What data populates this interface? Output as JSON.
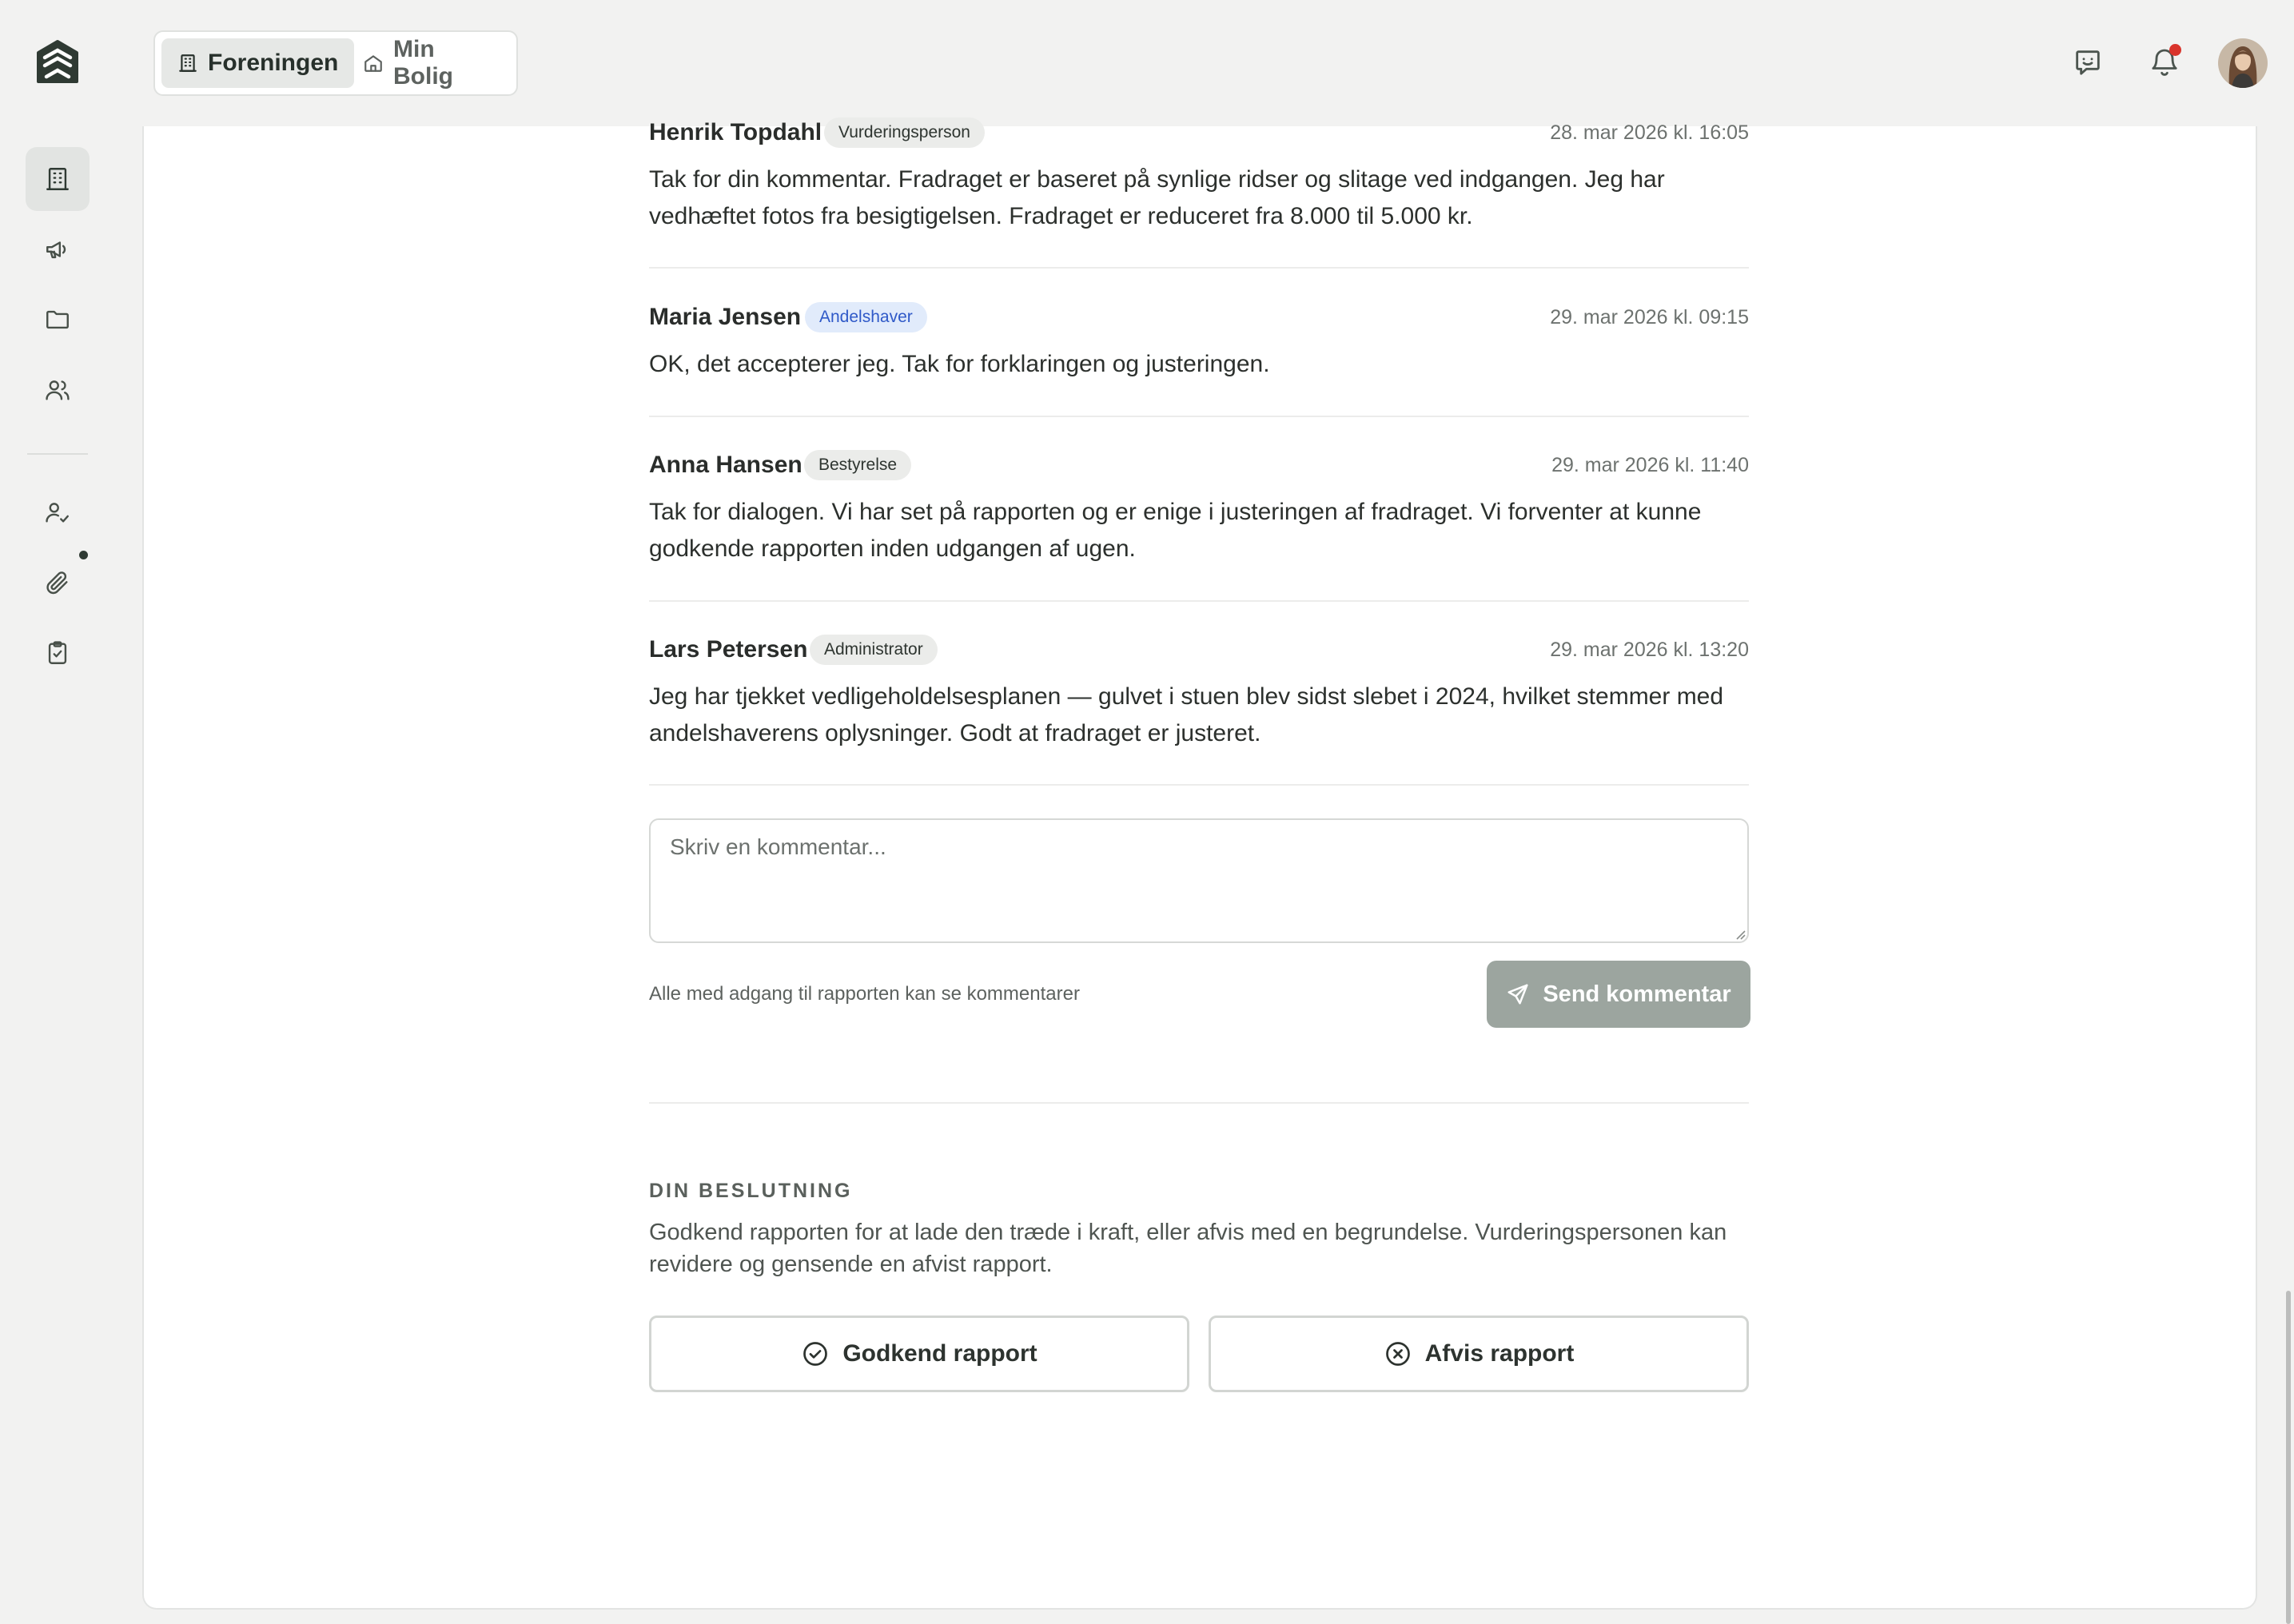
{
  "nav": {
    "tabs": [
      {
        "label": "Foreningen",
        "icon": "building-icon",
        "active": true
      },
      {
        "label": "Min Bolig",
        "icon": "home-icon",
        "active": false
      }
    ],
    "rail_icons": [
      "building-icon",
      "megaphone-icon",
      "folder-icon",
      "users-icon",
      "user-check-icon",
      "paperclip-icon",
      "clipboard-check-icon"
    ],
    "has_notification": true
  },
  "comments": [
    {
      "author": "Henrik Topdahl",
      "role": "Vurderingsperson",
      "time": "28. mar 2026 kl. 16:05",
      "body": "Tak for din kommentar. Fradraget er baseret på synlige ridser og slitage ved indgangen. Jeg har vedhæftet fotos fra besigtigelsen. Fradraget er reduceret fra 8.000 til 5.000 kr."
    },
    {
      "author": "Maria Jensen",
      "role": "Andelshaver",
      "time": "29. mar 2026 kl. 09:15",
      "body": "OK, det accepterer jeg. Tak for forklaringen og justeringen."
    },
    {
      "author": "Anna Hansen",
      "role": "Bestyrelse",
      "time": "29. mar 2026 kl. 11:40",
      "body": "Tak for dialogen. Vi har set på rapporten og er enige i justeringen af fradraget. Vi forventer at kunne godkende rapporten inden udgangen af ugen."
    },
    {
      "author": "Lars Petersen",
      "role": "Administrator",
      "time": "29. mar 2026 kl. 13:20",
      "body": "Jeg har tjekket vedligeholdelsesplanen — gulvet i stuen blev sidst slebet i 2024, hvilket stemmer med andelshaverens oplysninger. Godt at fradraget er justeret."
    }
  ],
  "composer": {
    "placeholder": "Skriv en kommentar...",
    "value": "",
    "hint": "Alle med adgang til rapporten kan se kommentarer",
    "send_label": "Send kommentar"
  },
  "decision": {
    "heading": "DIN BESLUTNING",
    "description": "Godkend rapporten for at lade den træde i kraft, eller afvis med en begrundelse. Vurderingspersonen kan revidere og gensende en afvist rapport.",
    "approve_label": "Godkend rapport",
    "reject_label": "Afvis rapport"
  },
  "colors": {
    "brand": "#2f3a33",
    "badge_owner_bg": "#e1ebfb",
    "badge_owner_text": "#2f59c8",
    "send_disabled": "#9ca59f",
    "notification": "#d9342b"
  }
}
